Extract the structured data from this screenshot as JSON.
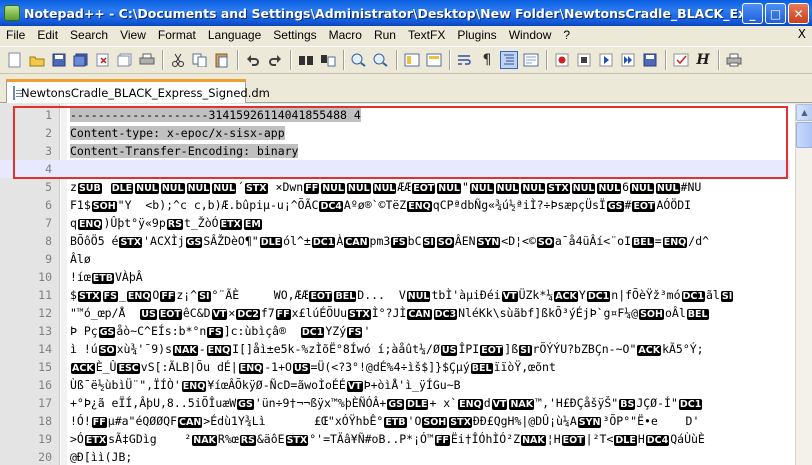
{
  "window": {
    "title": "Notepad++ - C:\\Documents and Settings\\Administrator\\Desktop\\New Folder\\NewtonsCradle_BLACK_Express_Sign...",
    "minimize": "_",
    "maximize": "□",
    "close": "✕"
  },
  "menu": {
    "items": [
      "File",
      "Edit",
      "Search",
      "View",
      "Format",
      "Language",
      "Settings",
      "Macro",
      "Run",
      "TextFX",
      "Plugins",
      "Window",
      "?"
    ],
    "close": "X"
  },
  "toolbar": {
    "icons": [
      "new-file-icon",
      "open-icon",
      "save-icon",
      "save-all-icon",
      "close-icon",
      "close-all-icon",
      "print-icon",
      "cut-icon",
      "copy-icon",
      "paste-icon",
      "undo-icon",
      "redo-icon",
      "find-icon",
      "replace-icon",
      "zoom-in-icon",
      "zoom-out-icon",
      "sync-v-icon",
      "sync-h-icon",
      "wrap-icon",
      "all-chars-icon",
      "indent-guide-icon",
      "udl-icon",
      "record-icon",
      "stop-icon",
      "play-icon",
      "play-multi-icon",
      "save-macro-icon",
      "spell-icon",
      "heading-icon",
      "print-now-icon"
    ]
  },
  "tab": {
    "label": "NewtonsCradle_BLACK_Express_Signed.dm"
  },
  "lines": [
    {
      "n": "1",
      "text": "--------------------31415926114041855488 4"
    },
    {
      "n": "2",
      "text": "Content-type: x-epoc/x-sisx-app"
    },
    {
      "n": "3",
      "text": "Content-Transfer-Encoding: binary"
    },
    {
      "n": "4",
      "text": ""
    },
    {
      "n": "5",
      "text": "zSUB DLENULNULNULNUL´STX ×DwnFFNULNULNULÆÆEOTNUL\"NULNULNULSTXNULNUL6NULNUL#NU"
    },
    {
      "n": "6",
      "text": "F1$SOH\"Y  <b);^c c,b)Æ.bûpiµ-u¡^ÕÃCDC4Aºø®`©TëZENQqCPªdbÑg«¾ú½ªiÌ?÷ÞsæpçÜsÏGS#EOTAÓÖDI"
    },
    {
      "n": "7",
      "text": "qENQ)Ûþt°ÿ«9pRSt_ŽòÓETXEM"
    },
    {
      "n": "8",
      "text": "BÕôÖ5 éSTX'ACXÌjGSSÂŽDèO¶\"DLEól^±DC1ÀCANpm3FSbCSISOÂENSYN<D¦<©SOa¯å4üÂí<¨oIBEL=ENQ/d^"
    },
    {
      "n": "9",
      "text": "Âlø"
    },
    {
      "n": "10",
      "text": "!íœETBVÀþÂ"
    },
    {
      "n": "11",
      "text": "$STXFS_ENQOFFz¡^SI°¨ÃÈ     WO,ÆÆEOTBELD...  VNULtbÌ'àµiÐéiVTÜZk*¼ACKYDC1n|fÕèŸž³móDC1ãlSI"
    },
    {
      "n": "12",
      "text": "\"™ó_œp/Å  USEOTêC&DVT×DC2f7FFx£lúÉÕUuSTXÌ°?JÌCANDC3NléKk\\sùãbf]ßkÕ³ýÉjÞ`g¤F¼@SOHoÂlBEL"
    },
    {
      "n": "13",
      "text": "Þ PçGSåò~C^EÍs:b*°nFS]c:ùbìçâ®  DC1YZýFS'"
    },
    {
      "n": "14",
      "text": "ì !úSOxù¾'¯9)sNAK-ENQI[]åì±e5k-%zÌõË°8Íwó í;àåût¼/ØUSÎPIEOT]ßSIrÕÝÝU?bZBÇn-~O\"ACKkÃ5°Ý;"
    },
    {
      "n": "15",
      "text": "ACKÈ_ÛESCvS[:ÃLB|Õu dÉ|ENQ-1+OUS=Ü(<?3°!@dÉ%4÷ìš$]}$ÇµýBELïïòŸ,œõnt"
    },
    {
      "n": "16",
      "text": "Ùß¯ë½ùbìÜ¨\",ÏÍÒ'ENQ¥íœÂÕkÿØ-ÑcD=ãwoÌoÉÉVTÞ+òìÅ'ì_ÿÍGu~B"
    },
    {
      "n": "17",
      "text": "+°Þ¿ã eÏÍ,ÂþU,8..5iÕÎuæWGS'ün÷9†¬¬ßÿx™%þÈÑÓÂ+GSDLE+ x`ENQdVTNAK™,'H£ÐÇåšÿŠ\"BSJÇØ-Í\"DC1"
    },
    {
      "n": "18",
      "text": "!Ó!FFµ#a\"éQØØQFCAN>Édù1Y¾Lì       £Œ\"xÓŸhbÊ°ETB'OSOHSTXÐÐ£QgH%|@DÛ¡ù¼ASYN³ÕP°\"Ë•e    D'"
    },
    {
      "n": "19",
      "text": ">ÓETXsÃ‡GDìg    ²NAKR%œRS&äôESTX°'=TÄâ¥Ñ#oB..P*¡Ó™FFËi†ÎÓhÌÓ²ZNAK¦HEOT|²T<DLEHDC4QáÙùÈ"
    },
    {
      "n": "20",
      "text": "@Ð[ìì(JB;"
    }
  ]
}
